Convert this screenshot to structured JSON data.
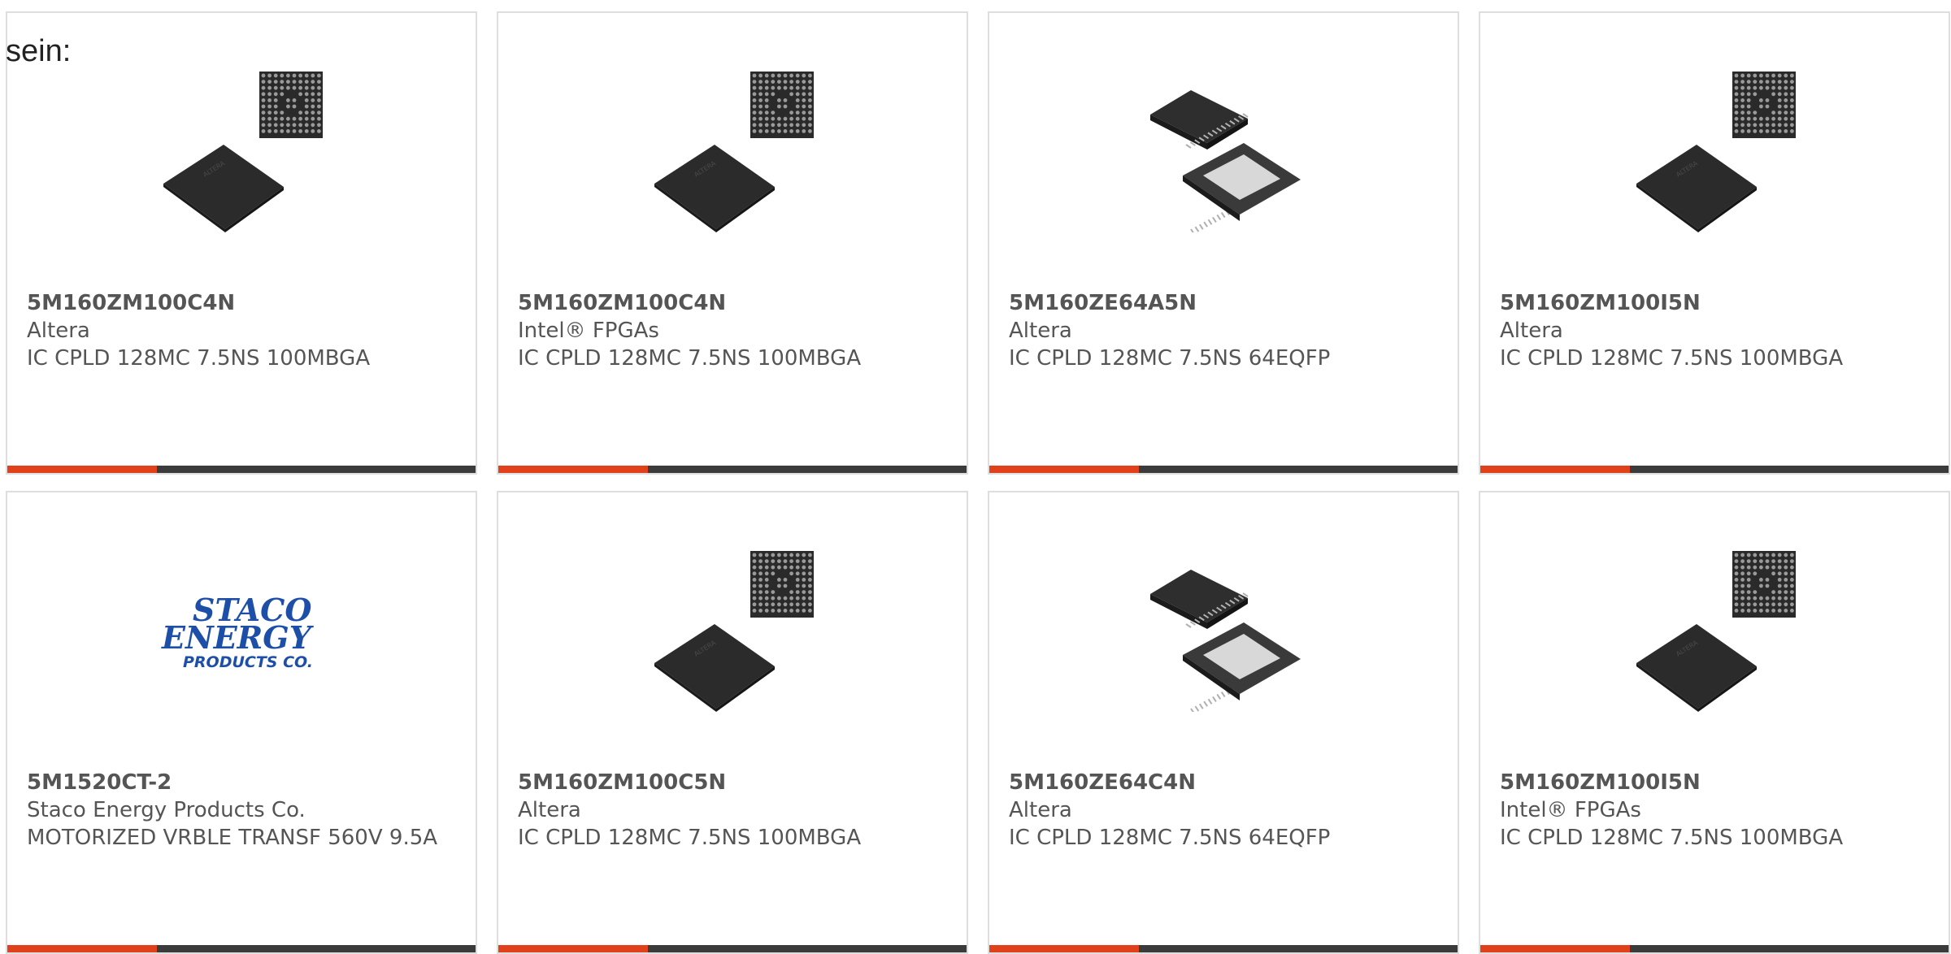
{
  "leading_text": "sein:",
  "colors": {
    "accent": "#e0401a",
    "bar_track": "#3b3b3b",
    "card_border": "#dedede",
    "text": "#555555",
    "logo_blue": "#1e4fa8"
  },
  "cards": [
    {
      "part_number": "5M160ZM100C4N",
      "manufacturer": "Altera",
      "description": "IC CPLD 128MC 7.5NS 100MBGA",
      "image_icon": "bga-chip-icon",
      "progress": 0.32
    },
    {
      "part_number": "5M160ZM100C4N",
      "manufacturer": "Intel® FPGAs",
      "description": "IC CPLD 128MC 7.5NS 100MBGA",
      "image_icon": "bga-chip-icon",
      "progress": 0.32
    },
    {
      "part_number": "5M160ZE64A5N",
      "manufacturer": "Altera",
      "description": "IC CPLD 128MC 7.5NS 64EQFP",
      "image_icon": "qfp-chip-icon",
      "progress": 0.32
    },
    {
      "part_number": "5M160ZM100I5N",
      "manufacturer": "Altera",
      "description": "IC CPLD 128MC 7.5NS 100MBGA",
      "image_icon": "bga-chip-icon",
      "progress": 0.32
    },
    {
      "part_number": "5M1520CT-2",
      "manufacturer": "Staco Energy Products Co.",
      "description": "MOTORIZED VRBLE TRANSF 560V 9.5A",
      "image_icon": "staco-logo-icon",
      "logo_lines": [
        "STACO",
        "ENERGY",
        "PRODUCTS CO."
      ],
      "progress": 0.32
    },
    {
      "part_number": "5M160ZM100C5N",
      "manufacturer": "Altera",
      "description": "IC CPLD 128MC 7.5NS 100MBGA",
      "image_icon": "bga-chip-icon",
      "progress": 0.32
    },
    {
      "part_number": "5M160ZE64C4N",
      "manufacturer": "Altera",
      "description": "IC CPLD 128MC 7.5NS 64EQFP",
      "image_icon": "qfp-chip-icon",
      "progress": 0.32
    },
    {
      "part_number": "5M160ZM100I5N",
      "manufacturer": "Intel® FPGAs",
      "description": "IC CPLD 128MC 7.5NS 100MBGA",
      "image_icon": "bga-chip-icon",
      "progress": 0.32
    }
  ]
}
